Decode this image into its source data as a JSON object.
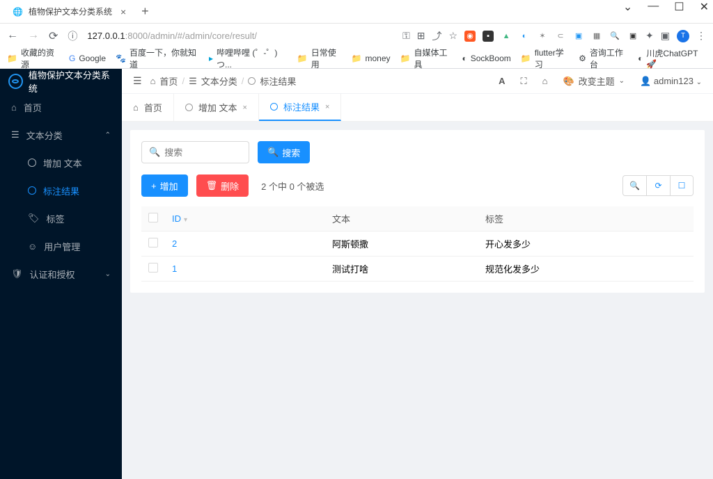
{
  "browser": {
    "tab_title": "植物保护文本分类系统",
    "url_host": "127.0.0.1",
    "url_port": ":8000",
    "url_path": "/admin/#/admin/core/result/",
    "avatar_letter": "T"
  },
  "bookmarks": [
    "收藏的资源",
    "Google",
    "百度一下，你就知道",
    "哔哩哔哩 (゜-゜)つ...",
    "日常使用",
    "money",
    "自媒体工具",
    "SockBoom",
    "flutter学习",
    "咨询工作台",
    "川虎ChatGPT 🚀"
  ],
  "sidebar": {
    "title": "植物保护文本分类系统",
    "items": [
      {
        "label": "首页",
        "icon": "home"
      },
      {
        "label": "文本分类",
        "icon": "list",
        "open": true,
        "children": [
          {
            "label": "增加 文本",
            "icon": "circle"
          },
          {
            "label": "标注结果",
            "icon": "circle",
            "active": true
          },
          {
            "label": "标签",
            "icon": "tag"
          },
          {
            "label": "用户管理",
            "icon": "user"
          }
        ]
      },
      {
        "label": "认证和授权",
        "icon": "shield"
      }
    ]
  },
  "topbar": {
    "crumbs": [
      "首页",
      "文本分类",
      "标注结果"
    ],
    "theme_label": "改变主题",
    "username": "admin123"
  },
  "tabs": [
    {
      "label": "首页",
      "icon": "home",
      "closable": false
    },
    {
      "label": "增加 文本",
      "closable": true
    },
    {
      "label": "标注结果",
      "closable": true,
      "active": true
    }
  ],
  "search": {
    "placeholder": "搜索",
    "button_label": "搜索"
  },
  "actions": {
    "add": "增加",
    "delete": "删除"
  },
  "count_text": "2 个中 0 个被选",
  "table": {
    "columns": [
      "ID",
      "文本",
      "标签"
    ],
    "rows": [
      {
        "id": "2",
        "text": "阿斯顿撒",
        "tag": "开心发多少"
      },
      {
        "id": "1",
        "text": "测试打啥",
        "tag": "规范化发多少"
      }
    ]
  }
}
